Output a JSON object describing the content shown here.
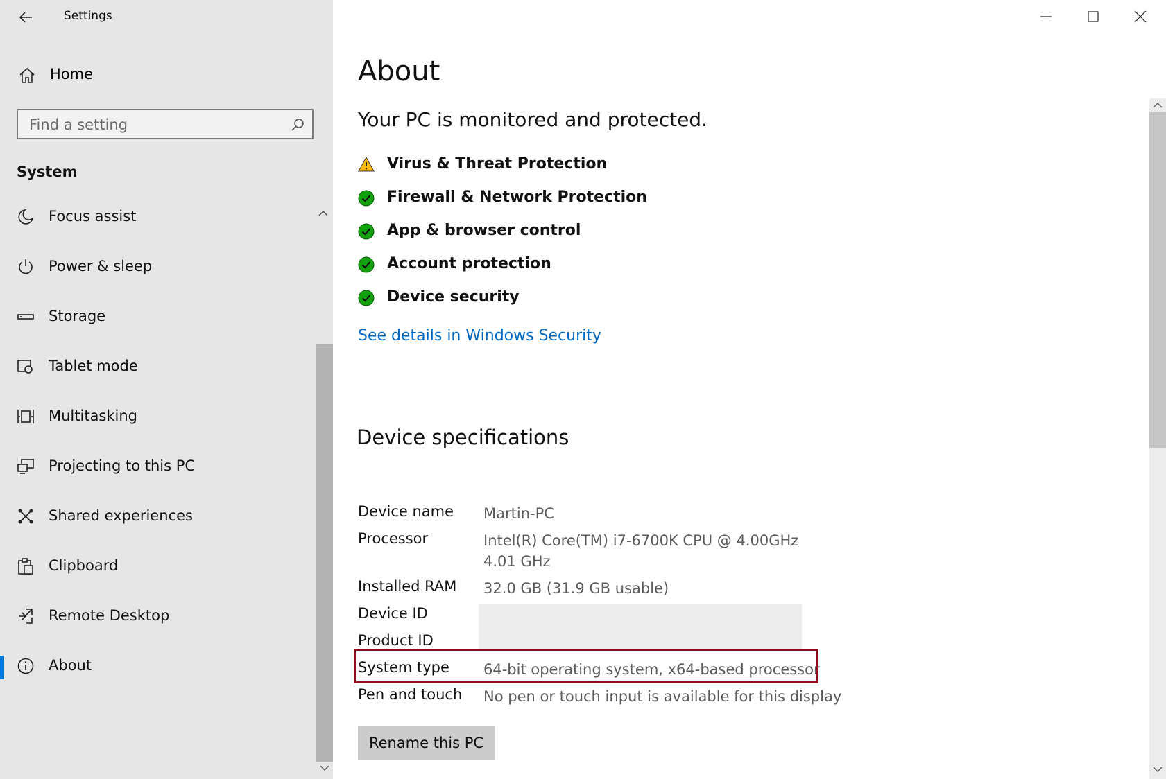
{
  "app": {
    "title": "Settings"
  },
  "sidebar": {
    "home_label": "Home",
    "search_placeholder": "Find a setting",
    "section_title": "System",
    "items": [
      {
        "label": "Focus assist",
        "icon": "moon-icon"
      },
      {
        "label": "Power & sleep",
        "icon": "power-icon"
      },
      {
        "label": "Storage",
        "icon": "storage-icon"
      },
      {
        "label": "Tablet mode",
        "icon": "tablet-mode-icon"
      },
      {
        "label": "Multitasking",
        "icon": "multitasking-icon"
      },
      {
        "label": "Projecting to this PC",
        "icon": "projecting-icon"
      },
      {
        "label": "Shared experiences",
        "icon": "shared-experiences-icon"
      },
      {
        "label": "Clipboard",
        "icon": "clipboard-icon"
      },
      {
        "label": "Remote Desktop",
        "icon": "remote-desktop-icon"
      },
      {
        "label": "About",
        "icon": "info-icon",
        "selected": true
      }
    ]
  },
  "main": {
    "title": "About",
    "status_heading": "Your PC is monitored and protected.",
    "protection_items": [
      {
        "label": "Virus & Threat Protection",
        "status": "warning"
      },
      {
        "label": "Firewall & Network Protection",
        "status": "ok"
      },
      {
        "label": "App & browser control",
        "status": "ok"
      },
      {
        "label": "Account protection",
        "status": "ok"
      },
      {
        "label": "Device security",
        "status": "ok"
      }
    ],
    "security_link": "See details in Windows Security",
    "specs_heading": "Device specifications",
    "specs": [
      {
        "key": "Device name",
        "value": "Martin-PC"
      },
      {
        "key": "Processor",
        "value": "Intel(R) Core(TM) i7-6700K CPU @ 4.00GHz   4.01 GHz"
      },
      {
        "key": "Installed RAM",
        "value": "32.0 GB (31.9 GB usable)"
      },
      {
        "key": "Device ID",
        "value": ""
      },
      {
        "key": "Product ID",
        "value": ""
      },
      {
        "key": "System type",
        "value": "64-bit operating system, x64-based processor"
      },
      {
        "key": "Pen and touch",
        "value": "No pen or touch input is available for this display"
      }
    ],
    "rename_button": "Rename this PC"
  },
  "colors": {
    "accent": "#0078d7",
    "link": "#0067c0",
    "ok": "#13a10e",
    "warning": "#ffb900",
    "highlight": "#8c0d1f",
    "sidebar_bg": "#e6e6e6"
  }
}
